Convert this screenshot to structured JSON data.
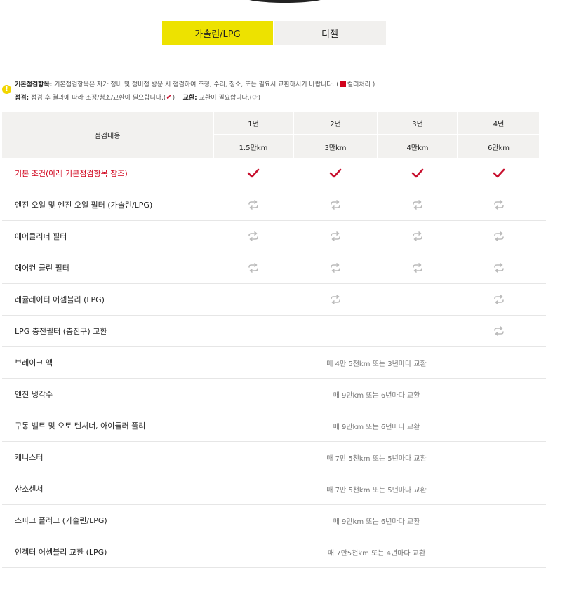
{
  "tabs": [
    {
      "label": "가솔린/LPG",
      "active": true
    },
    {
      "label": "디젤",
      "active": false
    }
  ],
  "legend": {
    "basic_title": "기본점검항목:",
    "basic_text": "기본점검항목은 자가 정비 및 정비점 방문 시 점검하여 조정, 수리, 청소, 또는 필요시 교환하시기 바랍니다. (",
    "basic_color_note": "컬러처리 )",
    "inspect_title": "점검:",
    "inspect_text": "점검 후 결과에 따라 조정/청소/교환이 필요합니다.(",
    "inspect_end": ")",
    "replace_title": "교환:",
    "replace_text": "교환이 필요합니다.(",
    "replace_end": ")"
  },
  "table": {
    "item_header": "점검내용",
    "years": [
      "1년",
      "2년",
      "3년",
      "4년"
    ],
    "kms": [
      "1.5만km",
      "3만km",
      "4만km",
      "6만km"
    ],
    "rows": [
      {
        "name": "기본 조건(아래 기본점검항목 참조)",
        "marks": [
          "check",
          "check",
          "check",
          "check"
        ]
      },
      {
        "name": "엔진 오일 및 엔진 오일 필터 (가솔린/LPG)",
        "marks": [
          "cycle",
          "cycle",
          "cycle",
          "cycle"
        ]
      },
      {
        "name": "에어클리너 필터",
        "marks": [
          "cycle",
          "cycle",
          "cycle",
          "cycle"
        ]
      },
      {
        "name": "에어컨 클린 필터",
        "marks": [
          "cycle",
          "cycle",
          "cycle",
          "cycle"
        ]
      },
      {
        "name": "레귤레이터 어셈블리 (LPG)",
        "marks": [
          "",
          "cycle",
          "",
          "cycle"
        ]
      },
      {
        "name": "LPG 충전필터 (충진구) 교환",
        "marks": [
          "",
          "",
          "",
          "cycle"
        ]
      },
      {
        "name": "브레이크 액",
        "note": "매 4만 5천km 또는 3년마다 교환"
      },
      {
        "name": "엔진 냉각수",
        "note": "매 9만km 또는 6년마다 교환"
      },
      {
        "name": "구동 벨트 및 오토 텐셔너, 아이들러 풀리",
        "note": "매 9만km 또는 6년마다 교환"
      },
      {
        "name": "캐니스터",
        "note": "매 7만 5천km 또는 5년마다 교환"
      },
      {
        "name": "산소센서",
        "note": "매 7만 5천km 또는 5년마다 교환"
      },
      {
        "name": "스파크 플러그 (가솔린/LPG)",
        "note": "매 9만km 또는 6년마다 교환"
      },
      {
        "name": "인젝터 어셈블리 교환 (LPG)",
        "note": "매 7만5천km 또는 4년마다 교환"
      }
    ]
  },
  "colors": {
    "accent": "#ede200",
    "check": "#c8102e",
    "cycle": "#bbbbbb",
    "basic_row": "#d0021b"
  }
}
